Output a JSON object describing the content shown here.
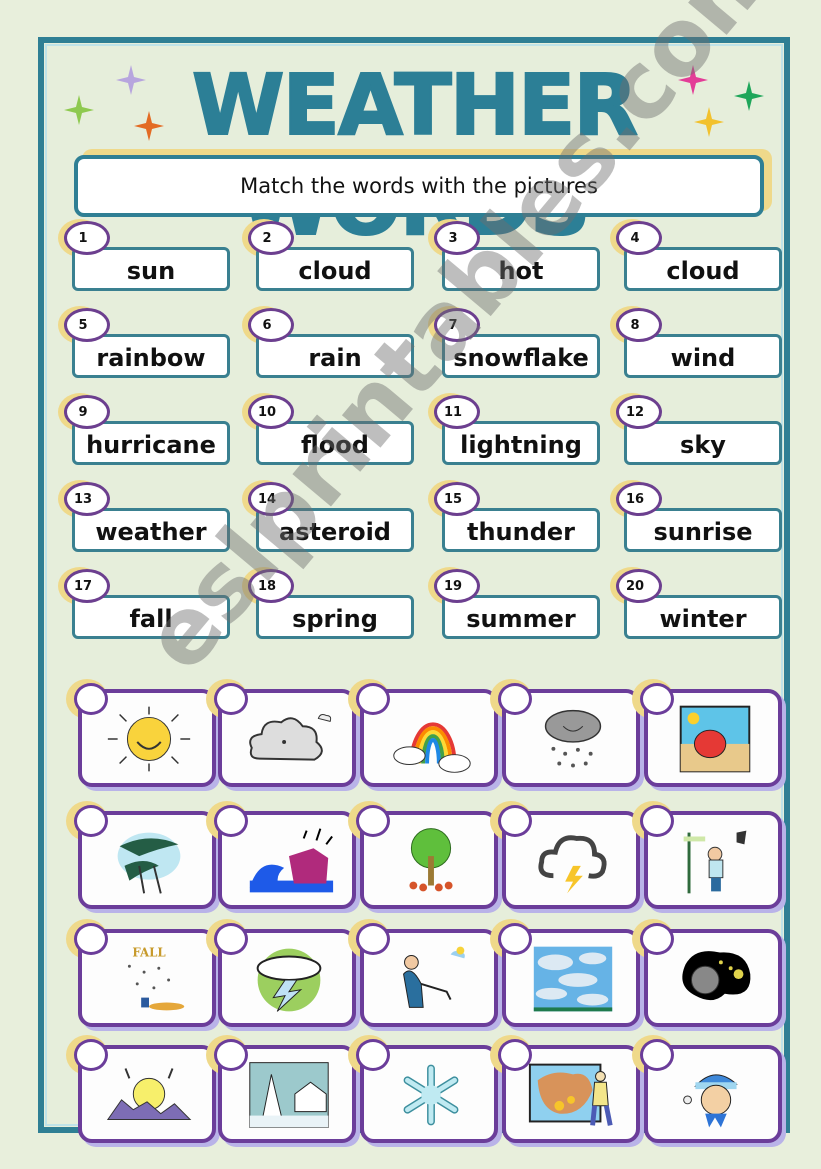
{
  "title": "WEATHER WORDS",
  "instruction": "Match  the words with the pictures",
  "watermark": "eslprintables.com",
  "colors": {
    "teal": "#2f7f94",
    "purple": "#6b3d9a",
    "gold": "#efd98a",
    "background": "#e6eedb"
  },
  "words": [
    {
      "num": "1",
      "word": "sun"
    },
    {
      "num": "2",
      "word": "cloud"
    },
    {
      "num": "3",
      "word": "hot"
    },
    {
      "num": "4",
      "word": "cloud"
    },
    {
      "num": "5",
      "word": "rainbow"
    },
    {
      "num": "6",
      "word": "rain"
    },
    {
      "num": "7",
      "word": "snowflake"
    },
    {
      "num": "8",
      "word": "wind"
    },
    {
      "num": "9",
      "word": "hurricane"
    },
    {
      "num": "10",
      "word": "flood"
    },
    {
      "num": "11",
      "word": "lightning"
    },
    {
      "num": "12",
      "word": "sky"
    },
    {
      "num": "13",
      "word": "weather"
    },
    {
      "num": "14",
      "word": "asteroid"
    },
    {
      "num": "15",
      "word": "thunder"
    },
    {
      "num": "16",
      "word": "sunrise"
    },
    {
      "num": "17",
      "word": "fall"
    },
    {
      "num": "18",
      "word": "spring"
    },
    {
      "num": "19",
      "word": "summer"
    },
    {
      "num": "20",
      "word": "winter"
    }
  ],
  "pictures": [
    {
      "icon": "smiling-sun-icon"
    },
    {
      "icon": "cloud-icon"
    },
    {
      "icon": "rainbow-icon"
    },
    {
      "icon": "rain-cloud-icon"
    },
    {
      "icon": "beach-umbrella-icon"
    },
    {
      "icon": "hurricane-trees-icon"
    },
    {
      "icon": "flood-house-icon"
    },
    {
      "icon": "spring-tree-icon"
    },
    {
      "icon": "thunder-cloud-icon"
    },
    {
      "icon": "windy-man-icon"
    },
    {
      "icon": "fall-leaves-icon",
      "caption": "FALL"
    },
    {
      "icon": "lightning-cloud-icon"
    },
    {
      "icon": "hot-sunbather-icon"
    },
    {
      "icon": "sky-clouds-icon"
    },
    {
      "icon": "asteroid-icon"
    },
    {
      "icon": "sunrise-icon"
    },
    {
      "icon": "winter-cottage-icon"
    },
    {
      "icon": "snowflake-icon"
    },
    {
      "icon": "weather-map-icon"
    },
    {
      "icon": "cold-kid-icon"
    }
  ]
}
